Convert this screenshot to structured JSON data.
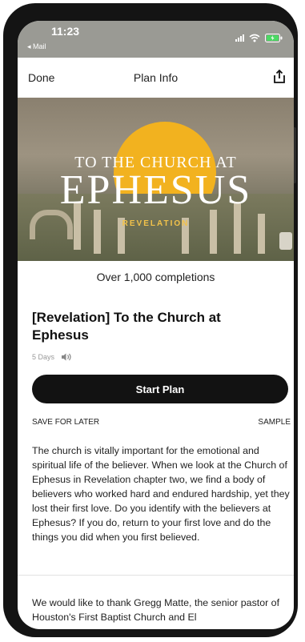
{
  "status_bar": {
    "time": "11:23",
    "back_app": "◂ Mail"
  },
  "nav": {
    "done_label": "Done",
    "title": "Plan Info"
  },
  "hero": {
    "line1": "TO THE CHURCH AT",
    "line2": "EPHESUS",
    "line3": "REVELATION"
  },
  "completions": "Over 1,000 completions",
  "plan": {
    "title": "[Revelation] To the Church at Ephesus",
    "days": "5 Days"
  },
  "actions": {
    "start_label": "Start Plan",
    "save_later_label": "SAVE FOR LATER",
    "sample_label": "SAMPLE"
  },
  "description": "The church is vitally important for the emotional and spiritual life of the believer. When we look at the Church of Ephesus in Revelation chapter two, we find a body of believers who worked hard and endured hardship, yet they lost their first love. Do you identify with the believers at Ephesus? If you do, return to your first love and do the things you did when you first believed.",
  "thanks": "We would like to thank Gregg Matte, the senior pastor of Houston's First Baptist Church and El",
  "colors": {
    "accent_sun": "#f2b21f",
    "button_bg": "#121212"
  },
  "icons": {
    "share": "share-icon",
    "audio": "speaker-icon",
    "wifi": "wifi-icon",
    "battery": "battery-icon",
    "signal": "signal-icon"
  }
}
